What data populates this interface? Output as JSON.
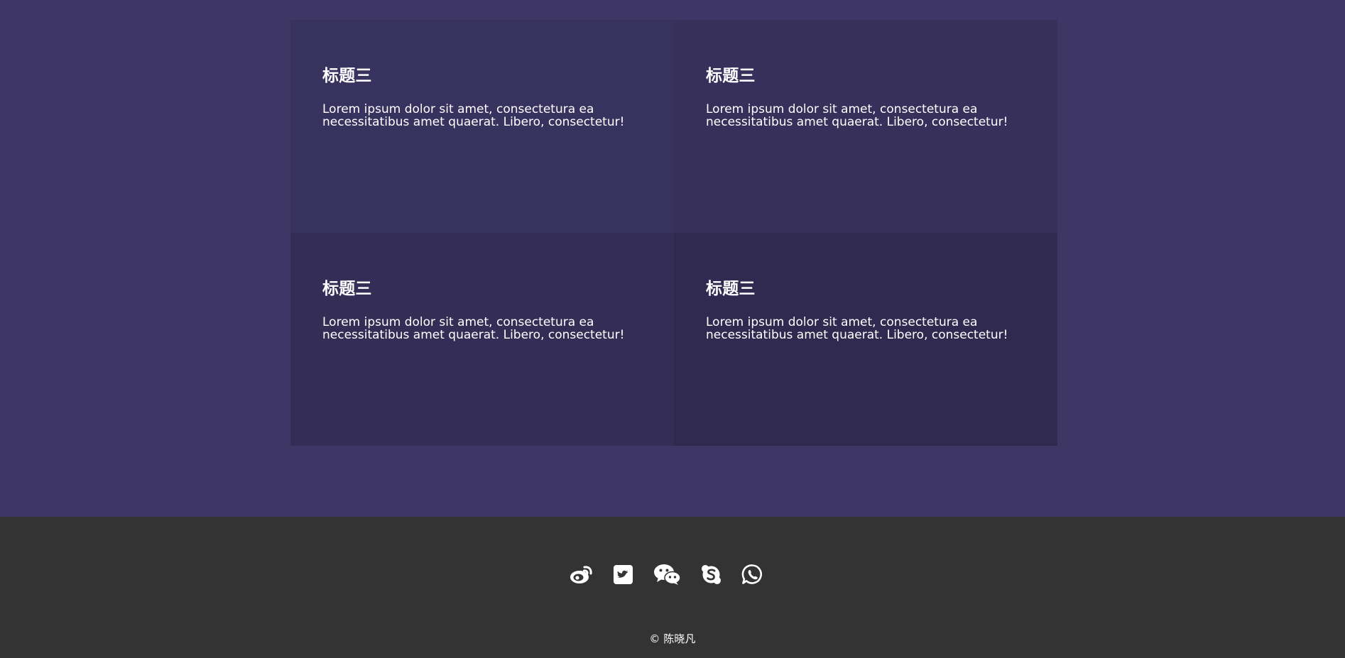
{
  "colors": {
    "page_background": "#3e3766",
    "card_1": "#38325e",
    "card_2": "#36305a",
    "card_3": "#342e56",
    "card_4": "#312a50",
    "footer_background": "#333333",
    "text": "#ffffff"
  },
  "cards": [
    {
      "title": "标题三",
      "text": "Lorem ipsum dolor sit amet, consectetura ea necessitatibus amet quaerat. Libero, consectetur!"
    },
    {
      "title": "标题三",
      "text": "Lorem ipsum dolor sit amet, consectetura ea necessitatibus amet quaerat. Libero, consectetur!"
    },
    {
      "title": "标题三",
      "text": "Lorem ipsum dolor sit amet, consectetura ea necessitatibus amet quaerat. Libero, consectetur!"
    },
    {
      "title": "标题三",
      "text": "Lorem ipsum dolor sit amet, consectetura ea necessitatibus amet quaerat. Libero, consectetur!"
    }
  ],
  "footer": {
    "social_icons": [
      "weibo-icon",
      "twitter-icon",
      "wechat-icon",
      "skype-icon",
      "whatsapp-icon"
    ],
    "copyright": "© 陈晓凡"
  }
}
